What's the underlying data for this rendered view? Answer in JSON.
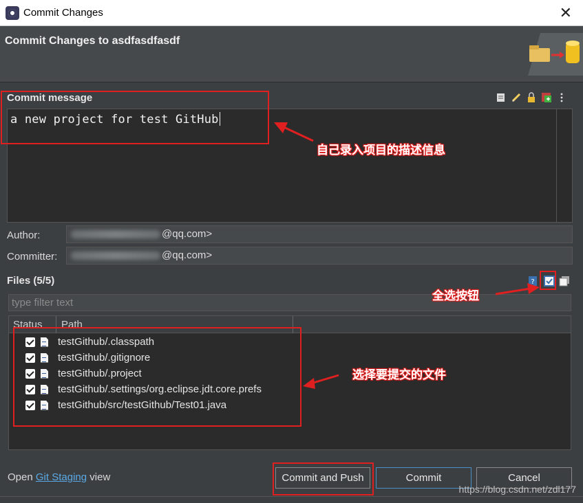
{
  "window": {
    "title": "Commit Changes"
  },
  "header": {
    "heading": "Commit Changes to asdfasdfasdf"
  },
  "commit_message": {
    "label": "Commit message",
    "text": "a new project for test GitHub"
  },
  "author": {
    "label": "Author:",
    "value_suffix": "@qq.com>"
  },
  "committer": {
    "label": "Committer:",
    "value_suffix": "@qq.com>"
  },
  "files": {
    "label": "Files (5/5)",
    "filter_placeholder": "type filter text",
    "columns": [
      "Status",
      "Path"
    ],
    "rows": [
      "testGithub/.classpath",
      "testGithub/.gitignore",
      "testGithub/.project",
      "testGithub/.settings/org.eclipse.jdt.core.prefs",
      "testGithub/src/testGithub/Test01.java"
    ]
  },
  "footer": {
    "open_prefix": "Open",
    "open_link": "Git Staging",
    "open_suffix": "view"
  },
  "buttons": {
    "commit_and_push": "Commit and Push",
    "commit": "Commit",
    "cancel": "Cancel"
  },
  "annotations": {
    "message_note": "自己录入项目的描述信息",
    "select_all_note": "全选按钮",
    "files_note": "选择要提交的文件"
  },
  "watermark": "https://blog.csdn.net/zdl177",
  "colors": {
    "highlight": "#e02020",
    "link": "#5aa9e6",
    "background": "#3c3f41"
  }
}
